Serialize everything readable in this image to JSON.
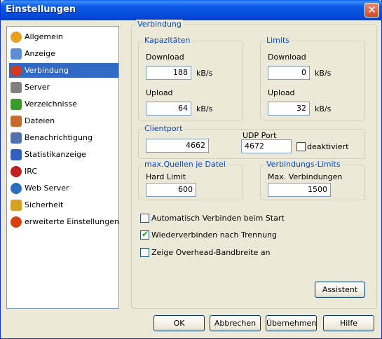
{
  "window": {
    "title": "Einstellungen",
    "close_symbol": "✕"
  },
  "sidebar": {
    "items": [
      {
        "label": "Allgemein",
        "icon": "gear-icon",
        "color": "#e8a020"
      },
      {
        "label": "Anzeige",
        "icon": "monitor-icon",
        "color": "#5b8fd6"
      },
      {
        "label": "Verbindung",
        "icon": "plug-icon",
        "color": "#d23a1e"
      },
      {
        "label": "Server",
        "icon": "server-icon",
        "color": "#808080"
      },
      {
        "label": "Verzeichnisse",
        "icon": "folder-icon",
        "color": "#3a9a2a"
      },
      {
        "label": "Dateien",
        "icon": "files-icon",
        "color": "#c86a2a"
      },
      {
        "label": "Benachrichtigung",
        "icon": "notification-icon",
        "color": "#5070b0"
      },
      {
        "label": "Statistikanzeige",
        "icon": "statistics-icon",
        "color": "#3060c0"
      },
      {
        "label": "IRC",
        "icon": "irc-icon",
        "color": "#c02020"
      },
      {
        "label": "Web Server",
        "icon": "globe-icon",
        "color": "#2a70c0"
      },
      {
        "label": "Sicherheit",
        "icon": "lock-icon",
        "color": "#d8a020"
      },
      {
        "label": "erweiterte Einstellungen",
        "icon": "advanced-settings-icon",
        "color": "#d84010"
      }
    ],
    "selected_index": 2
  },
  "main": {
    "title": "Verbindung",
    "capacity": {
      "legend": "Kapazitäten",
      "download_label": "Download",
      "download_value": "188",
      "upload_label": "Upload",
      "upload_value": "64",
      "unit": "kB/s"
    },
    "limits": {
      "legend": "Limits",
      "download_label": "Download",
      "download_value": "0",
      "upload_label": "Upload",
      "upload_value": "32",
      "unit": "kB/s"
    },
    "clientport": {
      "legend": "Clientport",
      "tcp_value": "4662",
      "udp_label": "UDP Port",
      "udp_value": "4672",
      "disabled_label": "deaktiviert",
      "disabled_checked": false
    },
    "max_sources": {
      "legend": "max.Quellen je Datei",
      "hard_limit_label": "Hard Limit",
      "hard_limit_value": "600"
    },
    "connection_limits": {
      "legend": "Verbindungs-Limits",
      "max_connections_label": "Max. Verbindungen",
      "max_connections_value": "1500"
    },
    "options": [
      {
        "label": "Automatisch Verbinden beim Start",
        "checked": false
      },
      {
        "label": "Wiederverbinden nach Trennung",
        "checked": true
      },
      {
        "label": "Zeige Overhead-Bandbreite an",
        "checked": false
      }
    ],
    "wizard_button": "Assistent"
  },
  "footer": {
    "ok": "OK",
    "cancel": "Abbrechen",
    "apply": "Übernehmen",
    "help": "Hilfe"
  },
  "colors": {
    "titlebar": "#0c5ce5",
    "selection": "#316ac5",
    "group_legend": "#0046d5",
    "dialog_background": "#ece9d8"
  }
}
